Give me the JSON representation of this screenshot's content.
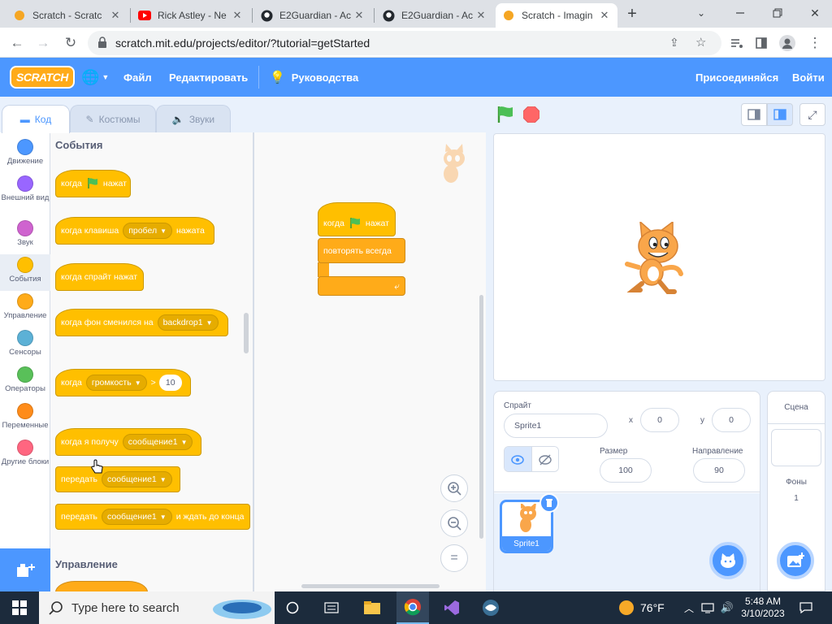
{
  "browser": {
    "tabs": [
      {
        "title": "Scratch - Scratc",
        "favicon": "scratch-favicon",
        "active": false
      },
      {
        "title": "Rick Astley - Ne",
        "favicon": "youtube-favicon",
        "active": false
      },
      {
        "title": "E2Guardian - Ac",
        "favicon": "github-favicon",
        "active": false
      },
      {
        "title": "E2Guardian - Ac",
        "favicon": "github-favicon",
        "active": false
      },
      {
        "title": "Scratch - Imagin",
        "favicon": "scratch-favicon",
        "active": true
      }
    ],
    "new_tab": "+",
    "url": "scratch.mit.edu/projects/editor/?tutorial=getStarted"
  },
  "menubar": {
    "logo": "SCRATCH",
    "file": "Файл",
    "edit": "Редактировать",
    "tutorials": "Руководства",
    "join": "Присоединяйся",
    "signin": "Войти"
  },
  "editor_tabs": {
    "code": "Код",
    "costumes": "Костюмы",
    "sounds": "Звуки"
  },
  "categories": [
    {
      "label": "Движение",
      "color": "#4c97ff"
    },
    {
      "label": "Внешний вид",
      "color": "#9966ff"
    },
    {
      "label": "Звук",
      "color": "#cf63cf"
    },
    {
      "label": "События",
      "color": "#ffbf00"
    },
    {
      "label": "Управление",
      "color": "#ffab19"
    },
    {
      "label": "Сенсоры",
      "color": "#5cb1d6"
    },
    {
      "label": "Операторы",
      "color": "#59c059"
    },
    {
      "label": "Переменные",
      "color": "#ff8c1a"
    },
    {
      "label": "Другие блоки",
      "color": "#ff6680"
    }
  ],
  "palette": {
    "events_header": "События",
    "control_header": "Управление",
    "blocks": {
      "when_flag_pre": "когда",
      "when_flag_post": "нажат",
      "key_pre": "когда клавиша",
      "key_dd": "пробел",
      "key_post": "нажата",
      "sprite_clicked": "когда спрайт нажат",
      "backdrop_pre": "когда фон сменился на",
      "backdrop_dd": "backdrop1",
      "gt_pre": "когда",
      "gt_dd": "громкость",
      "gt_op": ">",
      "gt_val": "10",
      "receive_pre": "когда я получу",
      "receive_dd": "сообщение1",
      "broadcast_pre": "передать",
      "broadcast_dd": "сообщение1",
      "broadcast_wait_pre": "передать",
      "broadcast_wait_dd": "сообщение1",
      "broadcast_wait_post": "и ждать до конца"
    }
  },
  "workspace": {
    "script_hat_pre": "когда",
    "script_hat_post": "нажат",
    "forever": "повторять всегда"
  },
  "sprite_info": {
    "label_sprite": "Спрайт",
    "sprite_name": "Sprite1",
    "x_label": "x",
    "x_value": "0",
    "y_label": "y",
    "y_value": "0",
    "size_label": "Размер",
    "size_value": "100",
    "direction_label": "Направление",
    "direction_value": "90"
  },
  "sprite_list": [
    {
      "name": "Sprite1"
    }
  ],
  "stage_pane": {
    "title": "Сцена",
    "backdrops_label": "Фоны",
    "backdrops_count": "1"
  },
  "taskbar": {
    "search_placeholder": "Type here to search",
    "weather": "76°F",
    "time": "5:48 AM",
    "date": "3/10/2023"
  },
  "colors": {
    "scratch_blue": "#4c97ff",
    "events_yellow": "#ffbf00",
    "stop_red": "#ff6666",
    "flag_green": "#4cbf56"
  }
}
